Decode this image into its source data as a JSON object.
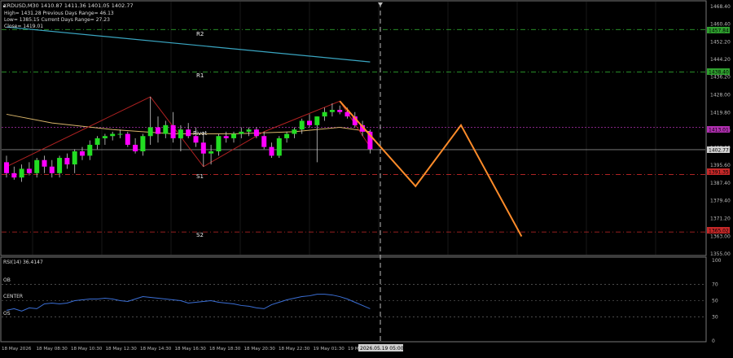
{
  "symbol_header": "XRDUSD,M30  1410.87 1411.36 1401.05 1402.77",
  "info_lines": [
    "High= 1431.28    Previous Days Range= 46.13",
    "Low= 1385.15    Current Days Range= 27.23",
    "Close= 1419.01"
  ],
  "levels": {
    "r2": {
      "label": "R2",
      "price": "1457.84"
    },
    "r1": {
      "label": "R1",
      "price": "1438.40"
    },
    "pivot": {
      "label": "Pivot",
      "price": "1413.01"
    },
    "s1": {
      "label": "S1",
      "price": "1391.35"
    },
    "s2": {
      "label": "S2",
      "price": "1365.02"
    },
    "current": {
      "price": "1402.77"
    }
  },
  "price_axis_ticks": [
    "1468.40",
    "1460.40",
    "1452.20",
    "1444.20",
    "1436.20",
    "1428.00",
    "1419.80",
    "1411.60",
    "1403.60",
    "1395.60",
    "1387.40",
    "1379.40",
    "1371.20",
    "1363.00",
    "1355.00"
  ],
  "rsi": {
    "title": "RSI(14) 36.4147",
    "ob_label": "OB",
    "center_label": "CENTER",
    "os_label": "OS",
    "ticks": [
      "100",
      "70",
      "50",
      "30",
      "0"
    ]
  },
  "time_axis": [
    "18 May 2026",
    "18 May 08:30",
    "18 May 10:30",
    "18 May 12:30",
    "18 May 14:30",
    "18 May 16:30",
    "18 May 18:30",
    "18 May 20:30",
    "18 May 22:30",
    "19 May 01:30",
    "19 May"
  ],
  "time_cursor_label": "2026.05.19 05:00",
  "colors": {
    "bull": "#22dd22",
    "bear": "#ff00ff",
    "wick": "#cccccc",
    "ma_slow": "#3aa6c2",
    "ma_fast": "#d9b56a",
    "forecast": "#ff8c2a",
    "zigzag": "#b22222",
    "grid": "#2a2a2a",
    "r_level": "#2ea02e",
    "s_level": "#c62828",
    "pivot_level": "#b02fb0",
    "rsi_line": "#3b6fd6"
  },
  "chart_data": {
    "type": "candlestick",
    "timeframe": "M30",
    "ylim": [
      1355,
      1470
    ],
    "candles": [
      {
        "o": 1397,
        "h": 1400,
        "l": 1390,
        "c": 1392
      },
      {
        "o": 1392,
        "h": 1395,
        "l": 1389,
        "c": 1390
      },
      {
        "o": 1390,
        "h": 1396,
        "l": 1388,
        "c": 1394
      },
      {
        "o": 1394,
        "h": 1397,
        "l": 1391,
        "c": 1392
      },
      {
        "o": 1392,
        "h": 1399,
        "l": 1390,
        "c": 1398
      },
      {
        "o": 1398,
        "h": 1400,
        "l": 1392,
        "c": 1395
      },
      {
        "o": 1395,
        "h": 1398,
        "l": 1390,
        "c": 1392
      },
      {
        "o": 1392,
        "h": 1400,
        "l": 1390,
        "c": 1399
      },
      {
        "o": 1399,
        "h": 1401,
        "l": 1394,
        "c": 1396
      },
      {
        "o": 1396,
        "h": 1403,
        "l": 1392,
        "c": 1402
      },
      {
        "o": 1402,
        "h": 1404,
        "l": 1398,
        "c": 1400
      },
      {
        "o": 1400,
        "h": 1407,
        "l": 1398,
        "c": 1405
      },
      {
        "o": 1405,
        "h": 1409,
        "l": 1403,
        "c": 1408
      },
      {
        "o": 1408,
        "h": 1410,
        "l": 1405,
        "c": 1409
      },
      {
        "o": 1409,
        "h": 1411,
        "l": 1407,
        "c": 1410
      },
      {
        "o": 1410,
        "h": 1412,
        "l": 1408,
        "c": 1410
      },
      {
        "o": 1410,
        "h": 1411,
        "l": 1404,
        "c": 1405
      },
      {
        "o": 1405,
        "h": 1408,
        "l": 1401,
        "c": 1402
      },
      {
        "o": 1402,
        "h": 1410,
        "l": 1400,
        "c": 1409
      },
      {
        "o": 1409,
        "h": 1427,
        "l": 1405,
        "c": 1413
      },
      {
        "o": 1413,
        "h": 1418,
        "l": 1406,
        "c": 1410
      },
      {
        "o": 1410,
        "h": 1416,
        "l": 1408,
        "c": 1414
      },
      {
        "o": 1414,
        "h": 1420,
        "l": 1406,
        "c": 1408
      },
      {
        "o": 1408,
        "h": 1414,
        "l": 1402,
        "c": 1412
      },
      {
        "o": 1412,
        "h": 1415,
        "l": 1408,
        "c": 1409
      },
      {
        "o": 1409,
        "h": 1413,
        "l": 1404,
        "c": 1406
      },
      {
        "o": 1406,
        "h": 1411,
        "l": 1395,
        "c": 1401
      },
      {
        "o": 1401,
        "h": 1405,
        "l": 1396,
        "c": 1402
      },
      {
        "o": 1402,
        "h": 1410,
        "l": 1400,
        "c": 1409
      },
      {
        "o": 1409,
        "h": 1411,
        "l": 1406,
        "c": 1408
      },
      {
        "o": 1408,
        "h": 1411,
        "l": 1406,
        "c": 1410
      },
      {
        "o": 1410,
        "h": 1413,
        "l": 1408,
        "c": 1411
      },
      {
        "o": 1411,
        "h": 1413,
        "l": 1409,
        "c": 1412
      },
      {
        "o": 1412,
        "h": 1413,
        "l": 1408,
        "c": 1409
      },
      {
        "o": 1409,
        "h": 1411,
        "l": 1403,
        "c": 1404
      },
      {
        "o": 1404,
        "h": 1406,
        "l": 1399,
        "c": 1400
      },
      {
        "o": 1400,
        "h": 1409,
        "l": 1399,
        "c": 1408
      },
      {
        "o": 1408,
        "h": 1411,
        "l": 1406,
        "c": 1410
      },
      {
        "o": 1410,
        "h": 1413,
        "l": 1408,
        "c": 1412
      },
      {
        "o": 1412,
        "h": 1417,
        "l": 1410,
        "c": 1416
      },
      {
        "o": 1416,
        "h": 1419,
        "l": 1413,
        "c": 1414
      },
      {
        "o": 1414,
        "h": 1418,
        "l": 1397,
        "c": 1418
      },
      {
        "o": 1418,
        "h": 1422,
        "l": 1416,
        "c": 1420
      },
      {
        "o": 1420,
        "h": 1424,
        "l": 1418,
        "c": 1421
      },
      {
        "o": 1421,
        "h": 1423,
        "l": 1419,
        "c": 1420
      },
      {
        "o": 1420,
        "h": 1422,
        "l": 1417,
        "c": 1418
      },
      {
        "o": 1418,
        "h": 1420,
        "l": 1413,
        "c": 1414
      },
      {
        "o": 1414,
        "h": 1416,
        "l": 1409,
        "c": 1411
      },
      {
        "o": 1411,
        "h": 1412,
        "l": 1401,
        "c": 1403
      }
    ],
    "ma_slow": [
      [
        0,
        1459
      ],
      [
        48,
        1443
      ]
    ],
    "ma_fast": [
      [
        0,
        1419
      ],
      [
        6,
        1415
      ],
      [
        14,
        1412
      ],
      [
        22,
        1410
      ],
      [
        30,
        1410
      ],
      [
        38,
        1411
      ],
      [
        44,
        1413
      ],
      [
        48,
        1411
      ]
    ],
    "zigzag": [
      [
        0,
        1395
      ],
      [
        19,
        1427
      ],
      [
        26,
        1395
      ],
      [
        34,
        1411
      ],
      [
        44,
        1425
      ],
      [
        48,
        1404
      ]
    ],
    "forecast": [
      [
        44,
        1425
      ],
      [
        54,
        1386
      ],
      [
        60,
        1414
      ],
      [
        68,
        1363
      ]
    ],
    "rsi_values": [
      38,
      40,
      37,
      41,
      40,
      46,
      47,
      46,
      47,
      50,
      51,
      52,
      52,
      53,
      52,
      50,
      49,
      52,
      55,
      54,
      53,
      52,
      51,
      50,
      47,
      48,
      49,
      50,
      48,
      47,
      46,
      44,
      43,
      41,
      40,
      45,
      48,
      51,
      53,
      55,
      56,
      58,
      58,
      57,
      55,
      52,
      48,
      44,
      40
    ]
  }
}
